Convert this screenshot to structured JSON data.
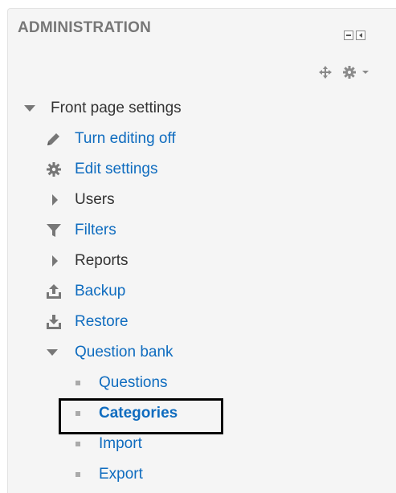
{
  "block": {
    "title": "ADMINISTRATION"
  },
  "tree": {
    "root": {
      "label": "Front page settings",
      "expanded": true
    },
    "items": [
      {
        "label": "Turn editing off",
        "icon": "pencil-icon",
        "link": true
      },
      {
        "label": "Edit settings",
        "icon": "gear-icon",
        "link": true
      },
      {
        "label": "Users",
        "icon": "caret-right-icon",
        "link": false
      },
      {
        "label": "Filters",
        "icon": "filter-icon",
        "link": true
      },
      {
        "label": "Reports",
        "icon": "caret-right-icon",
        "link": false
      },
      {
        "label": "Backup",
        "icon": "upload-icon",
        "link": true
      },
      {
        "label": "Restore",
        "icon": "download-icon",
        "link": true
      },
      {
        "label": "Question bank",
        "icon": "caret-down-icon",
        "link": true
      }
    ],
    "question_bank": [
      {
        "label": "Questions",
        "selected": false
      },
      {
        "label": "Categories",
        "selected": true
      },
      {
        "label": "Import",
        "selected": false
      },
      {
        "label": "Export",
        "selected": false
      }
    ]
  },
  "colors": {
    "link": "#0f6cbf",
    "text": "#333333",
    "title": "#777777",
    "panel": "#f5f5f5",
    "highlight_border": "#000000"
  }
}
